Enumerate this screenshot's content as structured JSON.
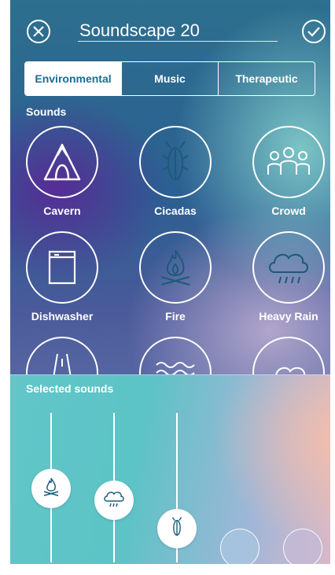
{
  "header": {
    "title": "Soundscape 20",
    "close_icon": "close-circle-icon",
    "confirm_icon": "check-circle-icon"
  },
  "tabs": [
    {
      "label": "Environmental",
      "active": true
    },
    {
      "label": "Music",
      "active": false
    },
    {
      "label": "Therapeutic",
      "active": false
    }
  ],
  "sounds_section": {
    "title": "Sounds"
  },
  "sounds": [
    {
      "label": "Cavern",
      "icon": "cavern-icon",
      "selected": false
    },
    {
      "label": "Cicadas",
      "icon": "cicada-icon",
      "selected": true
    },
    {
      "label": "Crowd",
      "icon": "crowd-icon",
      "selected": false
    },
    {
      "label": "Dishwasher",
      "icon": "dishwasher-icon",
      "selected": false
    },
    {
      "label": "Fire",
      "icon": "fire-icon",
      "selected": true
    },
    {
      "label": "Heavy Rain",
      "icon": "heavy-rain-icon",
      "selected": true
    }
  ],
  "partially_visible_sounds": [
    "road-icon",
    "waves-icon",
    "cloud-icon"
  ],
  "selected_section": {
    "title": "Selected sounds"
  },
  "selected_sounds": [
    {
      "icon": "fire-icon",
      "level": 0.62
    },
    {
      "icon": "heavy-rain-icon",
      "level": 0.47
    },
    {
      "icon": "cicada-icon",
      "level": 0.25
    }
  ],
  "colors": {
    "accent": "#1c6a92",
    "text": "#ffffff"
  }
}
